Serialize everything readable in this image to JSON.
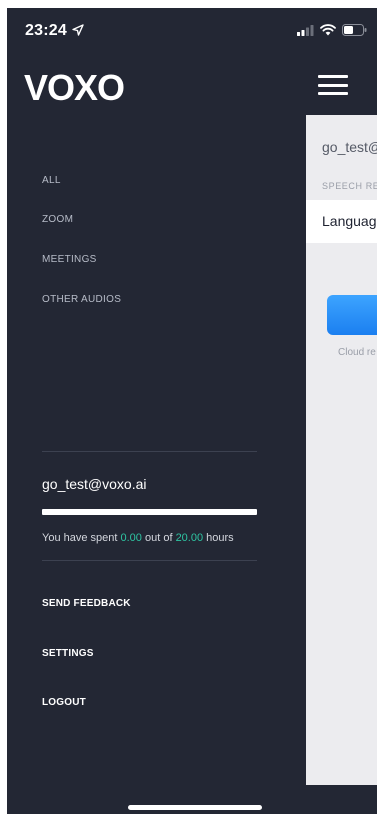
{
  "status_bar": {
    "time": "23:24",
    "icons": [
      "location-arrow-icon",
      "signal-icon",
      "wifi-icon",
      "battery-icon"
    ]
  },
  "brand": {
    "logo_text": "VOXO"
  },
  "drawer": {
    "nav_items": [
      {
        "label": "ALL"
      },
      {
        "label": "ZOOM"
      },
      {
        "label": "MEETINGS"
      },
      {
        "label": "OTHER AUDIOS"
      }
    ],
    "account": {
      "email": "go_test@voxo.ai",
      "usage_fraction": 1.0,
      "usage_prefix": "You have spent ",
      "spent": "0.00",
      "usage_middle": " out of ",
      "total": "20.00",
      "usage_suffix": " hours"
    },
    "actions": [
      {
        "label": "SEND FEEDBACK"
      },
      {
        "label": "SETTINGS"
      },
      {
        "label": "LOGOUT"
      }
    ]
  },
  "content_peek": {
    "email": "go_test@",
    "section_label": "SPEECH RE",
    "language_label": "Languag",
    "cloud_text": "Cloud re"
  },
  "colors": {
    "drawer_bg": "#232734",
    "accent_green": "#2ec4a2",
    "button_blue": "#1b7ff0",
    "content_bg": "#ececef"
  }
}
